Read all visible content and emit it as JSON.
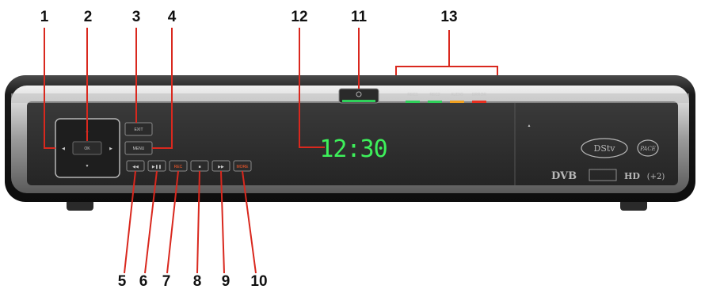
{
  "callouts": {
    "n1": "1",
    "n2": "2",
    "n3": "3",
    "n4": "4",
    "n5": "5",
    "n6": "6",
    "n7": "7",
    "n8": "8",
    "n9": "9",
    "n10": "10",
    "n11": "11",
    "n12": "12",
    "n13": "13"
  },
  "device": {
    "clock": "12:30",
    "ok_label": "OK",
    "top_button_label": "EXIT",
    "lower_button_label": "MENU",
    "transport_buttons": [
      "◀◀",
      "▶❚❚",
      "REC",
      "■",
      "▶▶",
      "MORE"
    ],
    "indicators": [
      "REC1",
      "REC2",
      "AUDIO",
      "ERROR"
    ],
    "brand_dstv": "DStv",
    "brand_pace": "PACE",
    "brand_dvb": "DVB",
    "brand_hd": "HD",
    "brand_plus2": "(+2)"
  },
  "colors": {
    "callout_line": "#d9281e",
    "clock_green": "#3df05a",
    "indicator_green": "#2fd05a",
    "indicator_orange": "#f0a020",
    "indicator_red": "#e83020"
  }
}
